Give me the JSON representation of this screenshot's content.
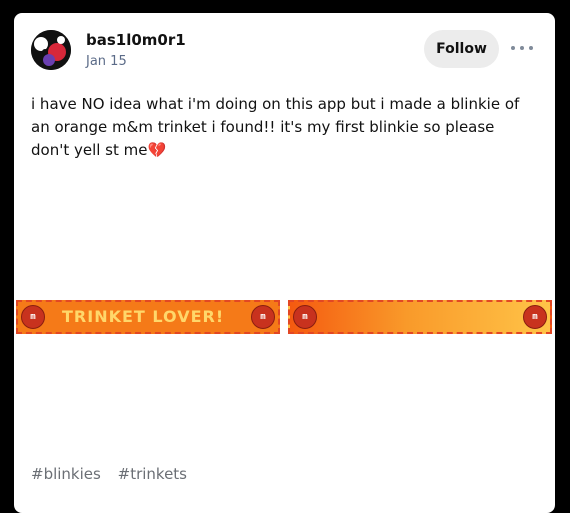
{
  "post": {
    "username": "bas1l0m0r1",
    "date": "Jan 15",
    "follow_label": "Follow",
    "more_icon": "more-horizontal-icon",
    "text": "i have NO idea what i'm doing on this app but i made a blinkie of an orange m&m trinket i found!! it's my first blinkie so please don't yell st me",
    "emoji": "💔",
    "blinkies": [
      {
        "text": "TRINKET LOVER!",
        "badge_left": "m",
        "badge_right": "m"
      },
      {
        "text": "",
        "badge_left": "m",
        "badge_right": "m"
      }
    ],
    "tags": [
      "#blinkies",
      "#trinkets"
    ]
  },
  "colors": {
    "card_bg": "#ffffff",
    "page_bg": "#000000",
    "blinkie_orange": "#f57a18",
    "blinkie_border": "#e24724",
    "blinkie_text": "#ffd76a",
    "mm_red": "#c8321e",
    "tag_gray": "#6b6f75"
  }
}
